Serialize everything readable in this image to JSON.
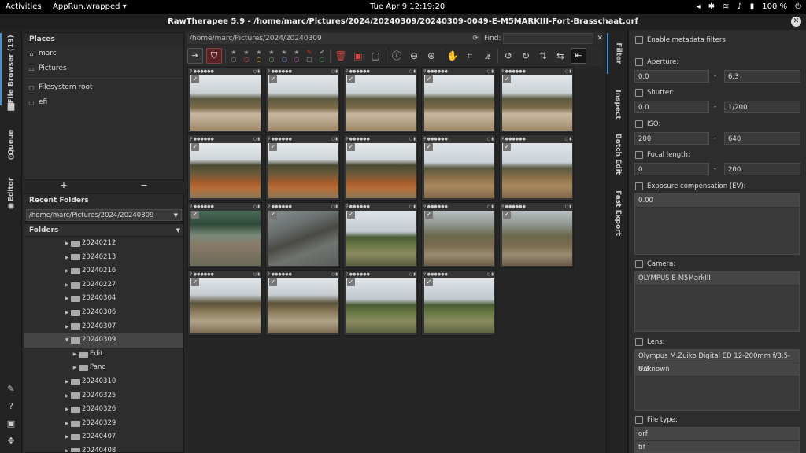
{
  "system_bar": {
    "activities": "Activities",
    "app_menu": "AppRun.wrapped",
    "clock": "Tue Apr 9  12:19:20",
    "battery": "100 %"
  },
  "window": {
    "title": "RawTherapee 5.9 - /home/marc/Pictures/2024/20240309/20240309-0049-E-M5MARKIII-Fort-Brasschaat.orf",
    "close": "✕"
  },
  "left_tabs": [
    "File Browser (19)",
    "Queue",
    "Editor"
  ],
  "places": {
    "header": "Places",
    "items": [
      {
        "label": "marc",
        "icon": "home-icon"
      },
      {
        "label": "Pictures",
        "icon": "folder-icon"
      },
      {
        "label": "Filesystem root",
        "icon": "drive-icon"
      },
      {
        "label": "efi",
        "icon": "drive-icon"
      }
    ],
    "add": "+",
    "remove": "−"
  },
  "recent": {
    "header": "Recent Folders",
    "value": "/home/marc/Pictures/2024/20240309"
  },
  "folders": {
    "header": "Folders",
    "items": [
      {
        "label": "20240212",
        "level": 0,
        "expanded": false,
        "selected": false
      },
      {
        "label": "20240213",
        "level": 0,
        "expanded": false,
        "selected": false
      },
      {
        "label": "20240216",
        "level": 0,
        "expanded": false,
        "selected": false
      },
      {
        "label": "20240227",
        "level": 0,
        "expanded": false,
        "selected": false
      },
      {
        "label": "20240304",
        "level": 0,
        "expanded": false,
        "selected": false
      },
      {
        "label": "20240306",
        "level": 0,
        "expanded": false,
        "selected": false
      },
      {
        "label": "20240307",
        "level": 0,
        "expanded": false,
        "selected": false
      },
      {
        "label": "20240309",
        "level": 0,
        "expanded": true,
        "selected": true
      },
      {
        "label": "Edit",
        "level": 1,
        "expanded": false,
        "selected": false
      },
      {
        "label": "Pano",
        "level": 1,
        "expanded": false,
        "selected": false
      },
      {
        "label": "20240310",
        "level": 0,
        "expanded": false,
        "selected": false
      },
      {
        "label": "20240325",
        "level": 0,
        "expanded": false,
        "selected": false
      },
      {
        "label": "20240326",
        "level": 0,
        "expanded": false,
        "selected": false
      },
      {
        "label": "20240329",
        "level": 0,
        "expanded": false,
        "selected": false
      },
      {
        "label": "20240407",
        "level": 0,
        "expanded": false,
        "selected": false
      },
      {
        "label": "20240408",
        "level": 0,
        "expanded": false,
        "selected": false
      }
    ]
  },
  "browser": {
    "path": "/home/marc/Pictures/2024/20240309",
    "find_label": "Find:",
    "find_value": ""
  },
  "thumbnails": [
    {
      "scene": "path"
    },
    {
      "scene": "path"
    },
    {
      "scene": "path"
    },
    {
      "scene": "path"
    },
    {
      "scene": "path"
    },
    {
      "scene": "lake"
    },
    {
      "scene": "lake"
    },
    {
      "scene": "lake"
    },
    {
      "scene": "hill"
    },
    {
      "scene": "hill"
    },
    {
      "scene": "water"
    },
    {
      "scene": "tree"
    },
    {
      "scene": "field"
    },
    {
      "scene": "ruin"
    },
    {
      "scene": "ruin"
    },
    {
      "scene": "fort"
    },
    {
      "scene": "fort"
    },
    {
      "scene": "field"
    },
    {
      "scene": "field"
    }
  ],
  "right_tabs": [
    "Filter",
    "Inspect",
    "Batch Edit",
    "Fast Export"
  ],
  "filter": {
    "enable_label": "Enable metadata filters",
    "aperture": {
      "label": "Aperture:",
      "from": "0.0",
      "to": "6.3"
    },
    "shutter": {
      "label": "Shutter:",
      "from": "0.0",
      "to": "1/200"
    },
    "iso": {
      "label": "ISO:",
      "from": "200",
      "to": "640"
    },
    "focal": {
      "label": "Focal length:",
      "from": "0",
      "to": "200"
    },
    "expcomp": {
      "label": "Exposure compensation (EV):",
      "items": [
        "0.00"
      ]
    },
    "camera": {
      "label": "Camera:",
      "items": [
        "OLYMPUS E-M5MarkIII"
      ]
    },
    "lens": {
      "label": "Lens:",
      "items": [
        "Olympus M.Zuiko Digital ED 12-200mm f/3.5-6.3",
        "Unknown"
      ]
    },
    "filetype": {
      "label": "File type:",
      "items": [
        "orf",
        "tif"
      ]
    },
    "dash": "-"
  },
  "colors": {
    "accent": "#4a90d9",
    "selection": "#454545"
  }
}
